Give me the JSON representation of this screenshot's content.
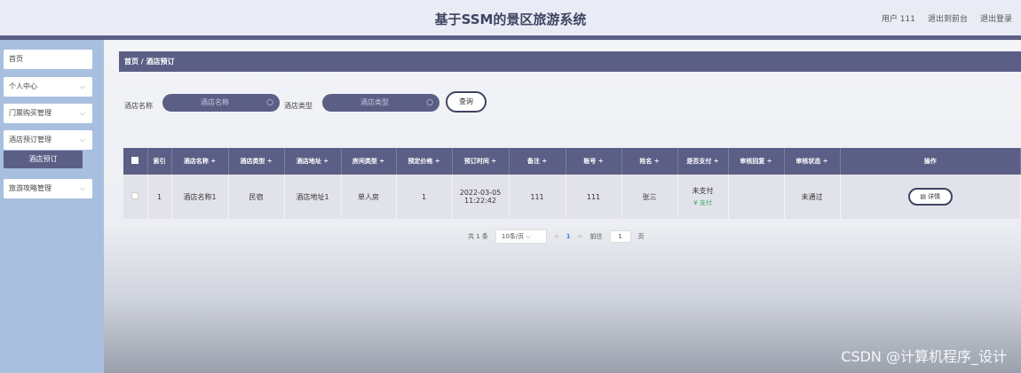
{
  "header": {
    "title": "基于SSM的景区旅游系统",
    "user": "用户 111",
    "to_front": "退出到前台",
    "logout": "退出登录"
  },
  "sidebar": {
    "items": [
      {
        "label": "首页"
      },
      {
        "label": "个人中心"
      },
      {
        "label": "门票购买管理"
      },
      {
        "label": "酒店预订管理"
      },
      {
        "label": "酒店预订"
      },
      {
        "label": "旅游攻略管理"
      }
    ]
  },
  "breadcrumb": "首页 / 酒店预订",
  "search": {
    "hotel_name_label": "酒店名称",
    "hotel_name_placeholder": "酒店名称",
    "hotel_type_label": "酒店类型",
    "hotel_type_placeholder": "酒店类型",
    "query_label": "查询"
  },
  "table": {
    "headers": [
      "索引",
      "酒店名称 ÷",
      "酒店类型 ÷",
      "酒店地址 ÷",
      "房间类型 ÷",
      "预定价格 ÷",
      "预订时间 ÷",
      "备注 ÷",
      "账号 ÷",
      "姓名 ÷",
      "是否支付 ÷",
      "审核回复 ÷",
      "审核状态 ÷",
      "操作"
    ],
    "rows": [
      {
        "index": "1",
        "hotel_name": "酒店名称1",
        "hotel_type": "民宿",
        "hotel_address": "酒店地址1",
        "room_type": "单人房",
        "price": "1",
        "booking_date": "2022-03-05",
        "booking_time": "11:22:42",
        "remark": "111",
        "account": "111",
        "name": "张三",
        "paid_status": "未支付",
        "pay_link": "¥ 支付",
        "review_reply": "",
        "review_status": "未通过",
        "detail_label": "详情"
      }
    ]
  },
  "pagination": {
    "total": "共 1 条",
    "page_size": "10条/页",
    "current": "1",
    "goto_label": "前往",
    "goto_value": "1",
    "page_unit": "页"
  },
  "watermark": "CSDN @计算机程序_设计"
}
